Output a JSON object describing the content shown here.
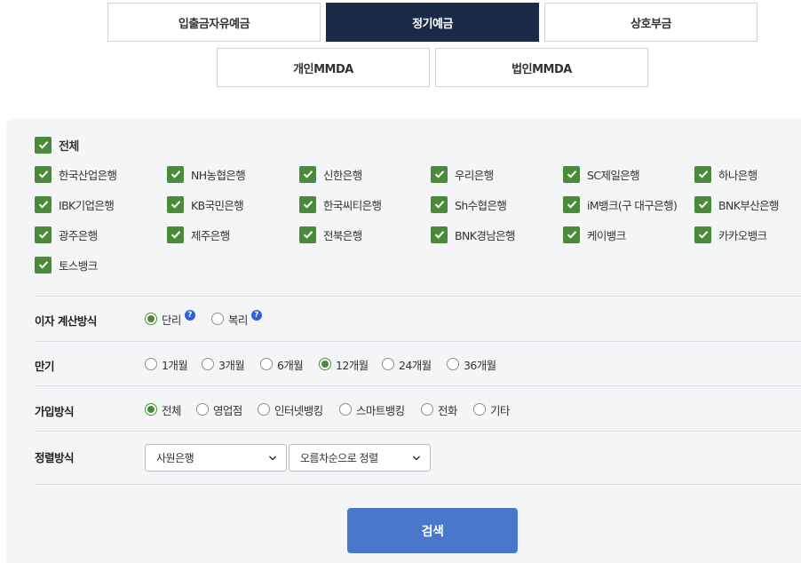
{
  "tabs_row1": [
    "입출금자유예금",
    "정기예금",
    "상호부금"
  ],
  "tabs_row2": [
    "개인MMDA",
    "법인MMDA"
  ],
  "banks": {
    "all_label": "전체",
    "items": [
      "한국산업은행",
      "NH농협은행",
      "신한은행",
      "우리은행",
      "SC제일은행",
      "하나은행",
      "IBK기업은행",
      "KB국민은행",
      "한국씨티은행",
      "Sh수협은행",
      "iM뱅크(구 대구은행)",
      "BNK부산은행",
      "광주은행",
      "제주은행",
      "전북은행",
      "BNK경남은행",
      "케이뱅크",
      "카카오뱅크",
      "토스뱅크"
    ]
  },
  "interest": {
    "label": "이자 계산방식",
    "options": [
      "단리",
      "복리"
    ],
    "help": "?"
  },
  "term": {
    "label": "만기",
    "options": [
      "1개월",
      "3개월",
      "6개월",
      "12개월",
      "24개월",
      "36개월"
    ]
  },
  "join": {
    "label": "가입방식",
    "options": [
      "전체",
      "영업점",
      "인터넷뱅킹",
      "스마트뱅킹",
      "전화",
      "기타"
    ]
  },
  "sort": {
    "label": "정렬방식",
    "select1": "사원은행",
    "select2": "오름차순으로 정렬"
  },
  "search_label": "검색",
  "colors": {
    "active_tab": "#1c2a4a",
    "check_green": "#4a8b3a",
    "search_blue": "#4a77c9"
  }
}
